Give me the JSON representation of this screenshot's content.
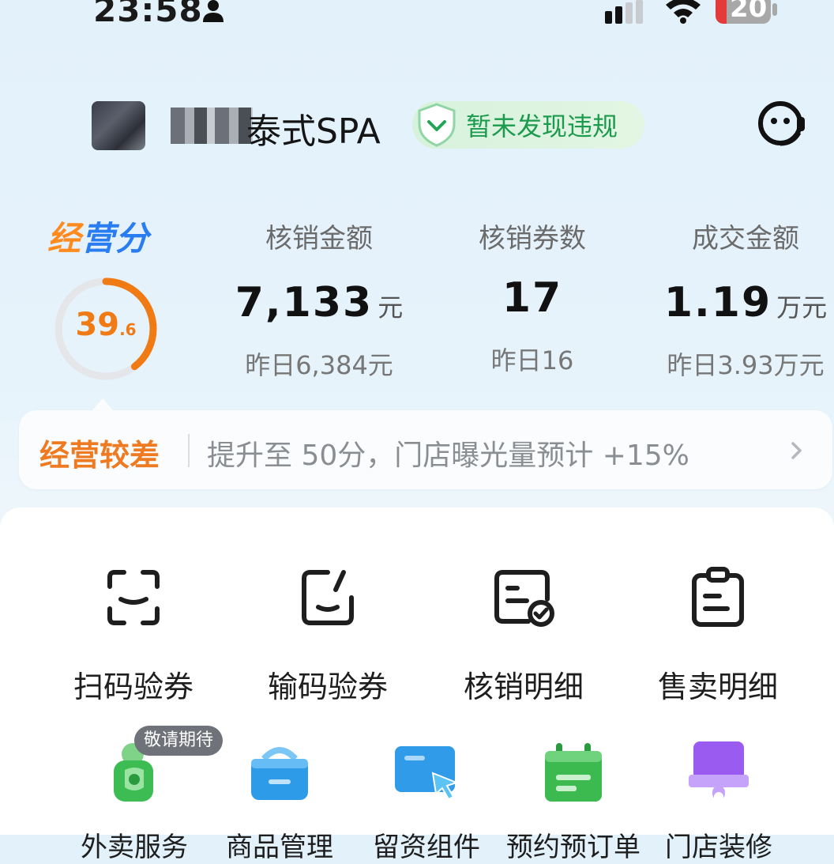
{
  "status_bar": {
    "time": "23:58",
    "battery": "20",
    "battery_level": 0.2
  },
  "header": {
    "store_name": "泰式SPA",
    "compliance_badge": "暂未发现违规",
    "service_icon": "customer-service-icon"
  },
  "score": {
    "title": "经营分",
    "value": "39",
    "decimal": ".6",
    "score": 39.6,
    "max": 100,
    "color": "#f07a14"
  },
  "metrics": [
    {
      "label": "核销金额",
      "value": "7,133",
      "unit": "元",
      "yesterday": "昨日6,384元"
    },
    {
      "label": "核销券数",
      "value": "17",
      "unit": "",
      "yesterday": "昨日16"
    },
    {
      "label": "成交金额",
      "value": "1.19",
      "unit": "万元",
      "yesterday": "昨日3.93万元"
    }
  ],
  "banner": {
    "status": "经营较差",
    "hint": "提升至 50分，门店曝光量预计 +15%"
  },
  "tools": [
    {
      "label": "扫码验券",
      "icon": "scan-icon"
    },
    {
      "label": "输码验券",
      "icon": "edit-code-icon"
    },
    {
      "label": "核销明细",
      "icon": "verify-detail-icon"
    },
    {
      "label": "售卖明细",
      "icon": "clipboard-icon"
    }
  ],
  "services": [
    {
      "label": "外卖服务",
      "icon": "delivery-icon",
      "badge": "敬请期待"
    },
    {
      "label": "商品管理",
      "icon": "basket-icon"
    },
    {
      "label": "留资组件",
      "icon": "lead-form-icon"
    },
    {
      "label": "预约预订单",
      "icon": "calendar-icon"
    },
    {
      "label": "门店装修",
      "icon": "store-decor-icon"
    }
  ],
  "colors": {
    "accent": "#2a7df0",
    "warning": "#ee7b22",
    "success": "#1c9a4d"
  }
}
